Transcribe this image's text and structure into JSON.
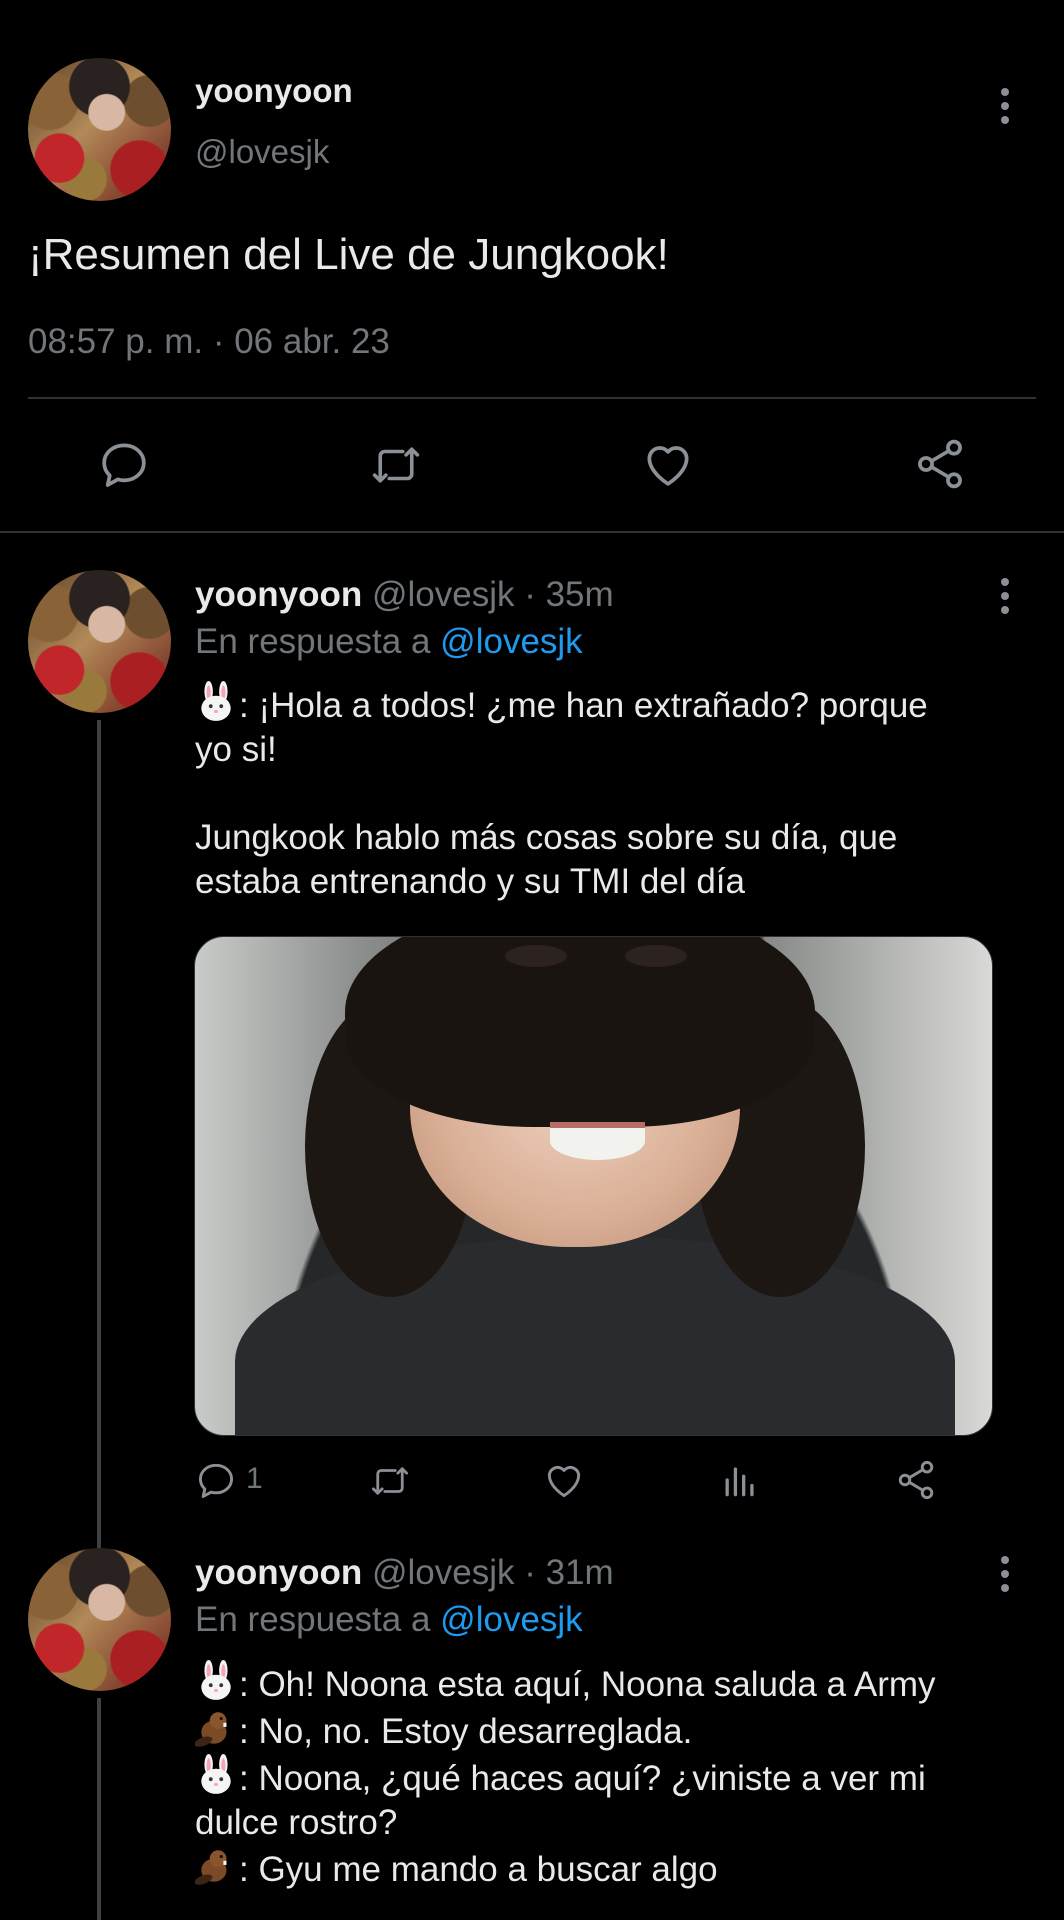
{
  "main_tweet": {
    "display_name": "yoonyoon",
    "handle": "@lovesjk",
    "text": "¡Resumen del Live de Jungkook!",
    "timestamp": "08:57 p. m. · 06 abr. 23",
    "actions": [
      "reply-icon",
      "retweet-icon",
      "like-icon",
      "share-icon"
    ]
  },
  "replies": [
    {
      "display_name": "yoonyoon",
      "handle": "@lovesjk",
      "time": "· 35m",
      "reply_prefix": "En respuesta a",
      "reply_mention": "@lovesjk",
      "body": {
        "line1": ": ¡Hola a todos! ¿me han extrañado? porque",
        "line2": "yo si!",
        "line3": "Jungkook hablo más cosas sobre su día, que",
        "line4": "estaba entrenando y su TMI del día"
      },
      "media": "photo",
      "reply_count": "1"
    },
    {
      "display_name": "yoonyoon",
      "handle": "@lovesjk",
      "time": "· 31m",
      "reply_prefix": "En respuesta a",
      "reply_mention": "@lovesjk",
      "body": {
        "line1": ": Oh! Noona esta aquí, Noona saluda a Army",
        "line2": ": No, no. Estoy desarreglada.",
        "line3": ": Noona, ¿qué haces aquí? ¿viniste a ver mi",
        "line4": "dulce rostro?",
        "line5": ": Gyu me mando a buscar algo"
      }
    }
  ],
  "colors": {
    "background": "#000000",
    "text_primary": "#e7e9ea",
    "text_secondary": "#71767b",
    "link": "#1d9bf0",
    "divider": "#2f3336"
  }
}
